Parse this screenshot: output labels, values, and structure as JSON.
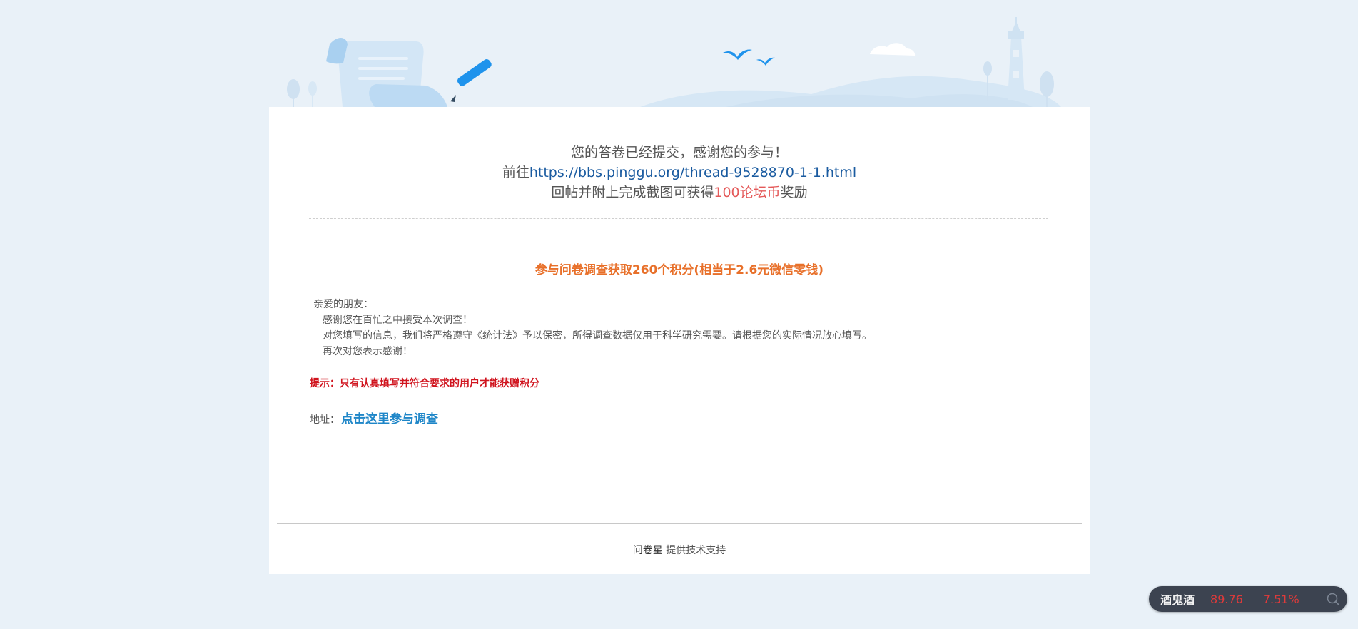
{
  "result": {
    "line1": "您的答卷已经提交，感谢您的参与！",
    "line2_prefix": "前往",
    "line2_link": "https://bbs.pinggu.org/thread-9528870-1-1.html",
    "line3_prefix": "回帖并附上完成截图可获得",
    "line3_reward": "100论坛币",
    "line3_suffix": "奖励"
  },
  "survey": {
    "title": "参与问卷调查获取260个积分(相当于2.6元微信零钱)",
    "greeting": "亲爱的朋友：",
    "paragraphs": [
      "感谢您在百忙之中接受本次调查！",
      "对您填写的信息，我们将严格遵守《统计法》予以保密，所得调查数据仅用于科学研究需要。请根据您的实际情况放心填写。",
      "再次对您表示感谢！"
    ],
    "tip": "提示：只有认真填写并符合要求的用户才能获赠积分",
    "address_label": "地址：",
    "address_link": "点击这里参与调查"
  },
  "footer": {
    "brand": "问卷星",
    "text": " 提供技术支持"
  },
  "ticker": {
    "name": "酒鬼酒",
    "price": "89.76",
    "change": "7.51%",
    "color": "#e03a3a",
    "icon": "search-icon"
  },
  "colors": {
    "background": "#e9f1f8",
    "link": "#1a5ba0",
    "reward": "#e45a5a",
    "survey_title": "#e8702a",
    "tip": "#d0141e",
    "survey_link": "#1e86c8"
  }
}
